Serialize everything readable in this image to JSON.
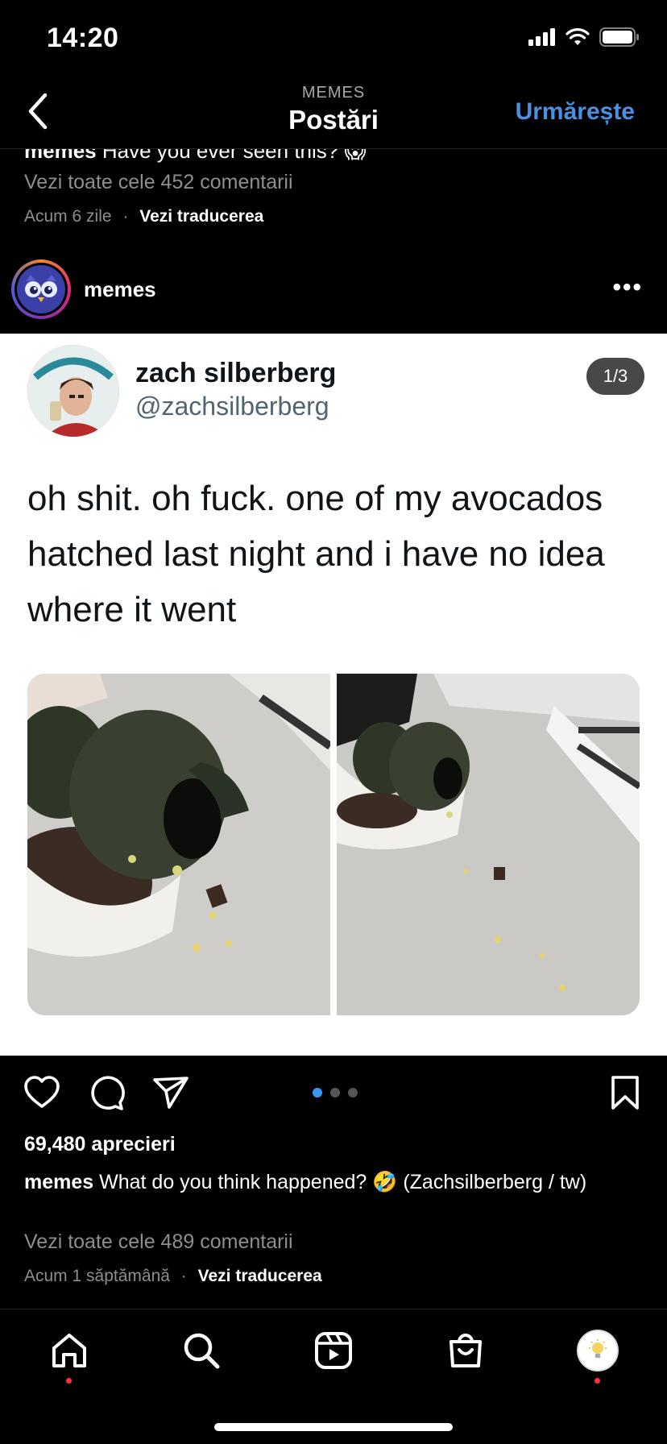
{
  "status_bar": {
    "time": "14:20"
  },
  "nav": {
    "subtitle": "MEMES",
    "title": "Postări",
    "follow_label": "Urmărește"
  },
  "previous_post": {
    "username": "memes",
    "caption": "Have you ever seen this? 😱",
    "comments_label": "Vezi toate cele 452 comentarii",
    "time": "Acum 6 zile",
    "separator": "·",
    "translate_label": "Vezi traducerea"
  },
  "post": {
    "username": "memes",
    "more_label": "•••",
    "media": {
      "counter": "1/3",
      "tweet_name": "zach silberberg",
      "tweet_handle": "@zachsilberberg",
      "tweet_text": "oh shit. oh fuck. one of my avocados hatched last night and i have no idea where it went",
      "pager": {
        "total": 3,
        "active": 1
      }
    },
    "likes": "69,480 aprecieri",
    "caption_user": "memes",
    "caption": "What do you think happened? 🤣 (Zachsilberberg / tw)",
    "comments_label": "Vezi toate cele 489 comentarii",
    "time": "Acum 1 săptămână",
    "separator": "·",
    "translate_label": "Vezi traducerea"
  },
  "icons": {
    "like": "heart-icon",
    "comment": "comment-icon",
    "share": "send-icon",
    "save": "bookmark-icon",
    "tabs": [
      "home-icon",
      "search-icon",
      "reels-icon",
      "shop-icon",
      "profile-avatar"
    ]
  },
  "colors": {
    "accent": "#4a90e2",
    "notification": "#ff3040",
    "pager_active": "#3897f0"
  }
}
